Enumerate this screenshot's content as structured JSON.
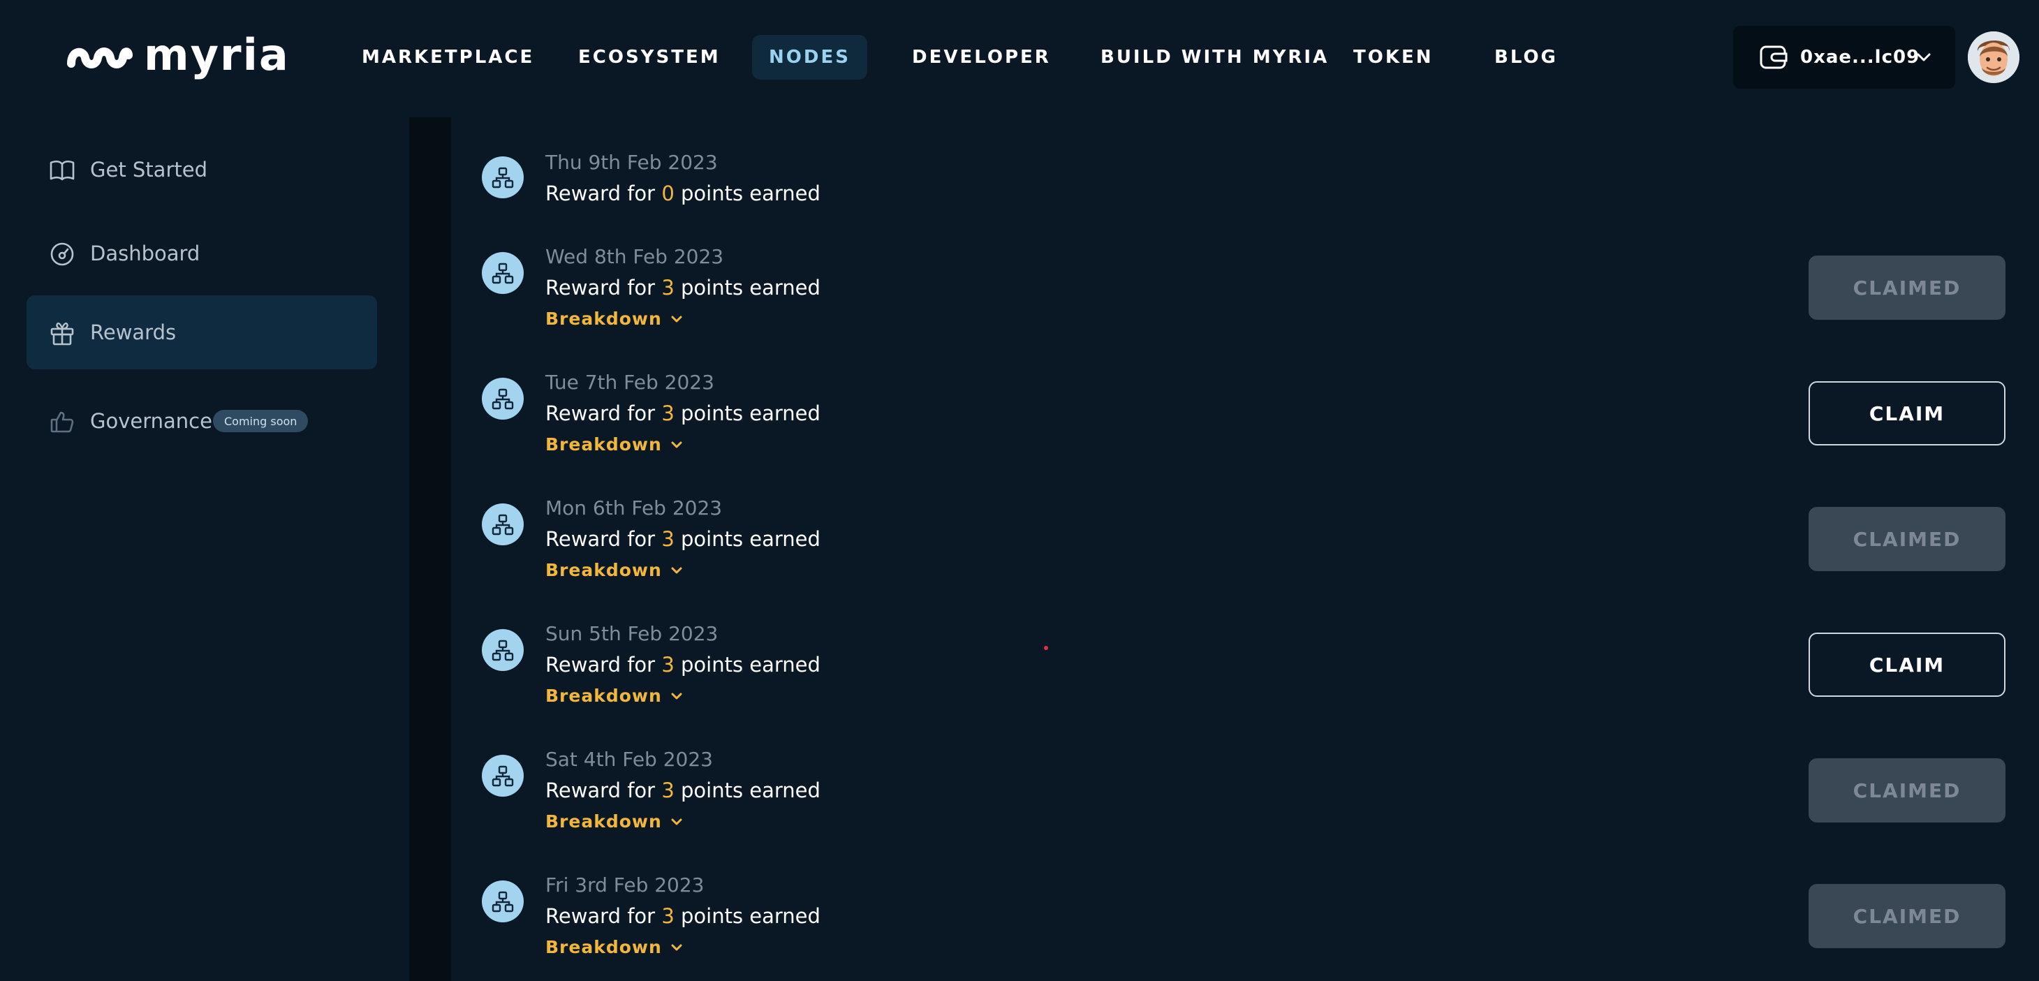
{
  "brand": {
    "logo_text": "myria"
  },
  "nav": {
    "items": [
      {
        "label": "MARKETPLACE",
        "active": false
      },
      {
        "label": "ECOSYSTEM",
        "active": false
      },
      {
        "label": "NODES",
        "active": true
      },
      {
        "label": "DEVELOPER",
        "active": false
      },
      {
        "label": "BUILD WITH MYRIA",
        "active": false
      },
      {
        "label": "TOKEN",
        "active": false
      },
      {
        "label": "BLOG",
        "active": false
      }
    ]
  },
  "wallet": {
    "address": "0xae...lc09",
    "icon": "wallet-icon"
  },
  "sidebar": {
    "items": [
      {
        "label": "Get Started",
        "icon": "book-icon",
        "active": false
      },
      {
        "label": "Dashboard",
        "icon": "gauge-icon",
        "active": false
      },
      {
        "label": "Rewards",
        "icon": "gift-icon",
        "active": true
      },
      {
        "label": "Governance",
        "icon": "thumbs-up-icon",
        "active": false,
        "badge": "Coming soon"
      }
    ]
  },
  "rewards": {
    "title_prefix": "Reward for",
    "title_suffix": "points earned",
    "breakdown_label": "Breakdown",
    "items": [
      {
        "date": "Thu 9th Feb 2023",
        "points": "0",
        "status": "",
        "has_breakdown": false
      },
      {
        "date": "Wed 8th Feb 2023",
        "points": "3",
        "status": "CLAIMED",
        "has_breakdown": true
      },
      {
        "date": "Tue 7th Feb 2023",
        "points": "3",
        "status": "CLAIM",
        "has_breakdown": true
      },
      {
        "date": "Mon 6th Feb 2023",
        "points": "3",
        "status": "CLAIMED",
        "has_breakdown": true
      },
      {
        "date": "Sun 5th Feb 2023",
        "points": "3",
        "status": "CLAIM",
        "has_breakdown": true
      },
      {
        "date": "Sat 4th Feb 2023",
        "points": "3",
        "status": "CLAIMED",
        "has_breakdown": true
      },
      {
        "date": "Fri 3rd Feb 2023",
        "points": "3",
        "status": "CLAIMED",
        "has_breakdown": true
      }
    ]
  },
  "colors": {
    "background": "#0a1826",
    "accent": "#f2b73a",
    "nav_active": "#9ad2ef",
    "node_icon_bg": "#a3d4ef"
  }
}
